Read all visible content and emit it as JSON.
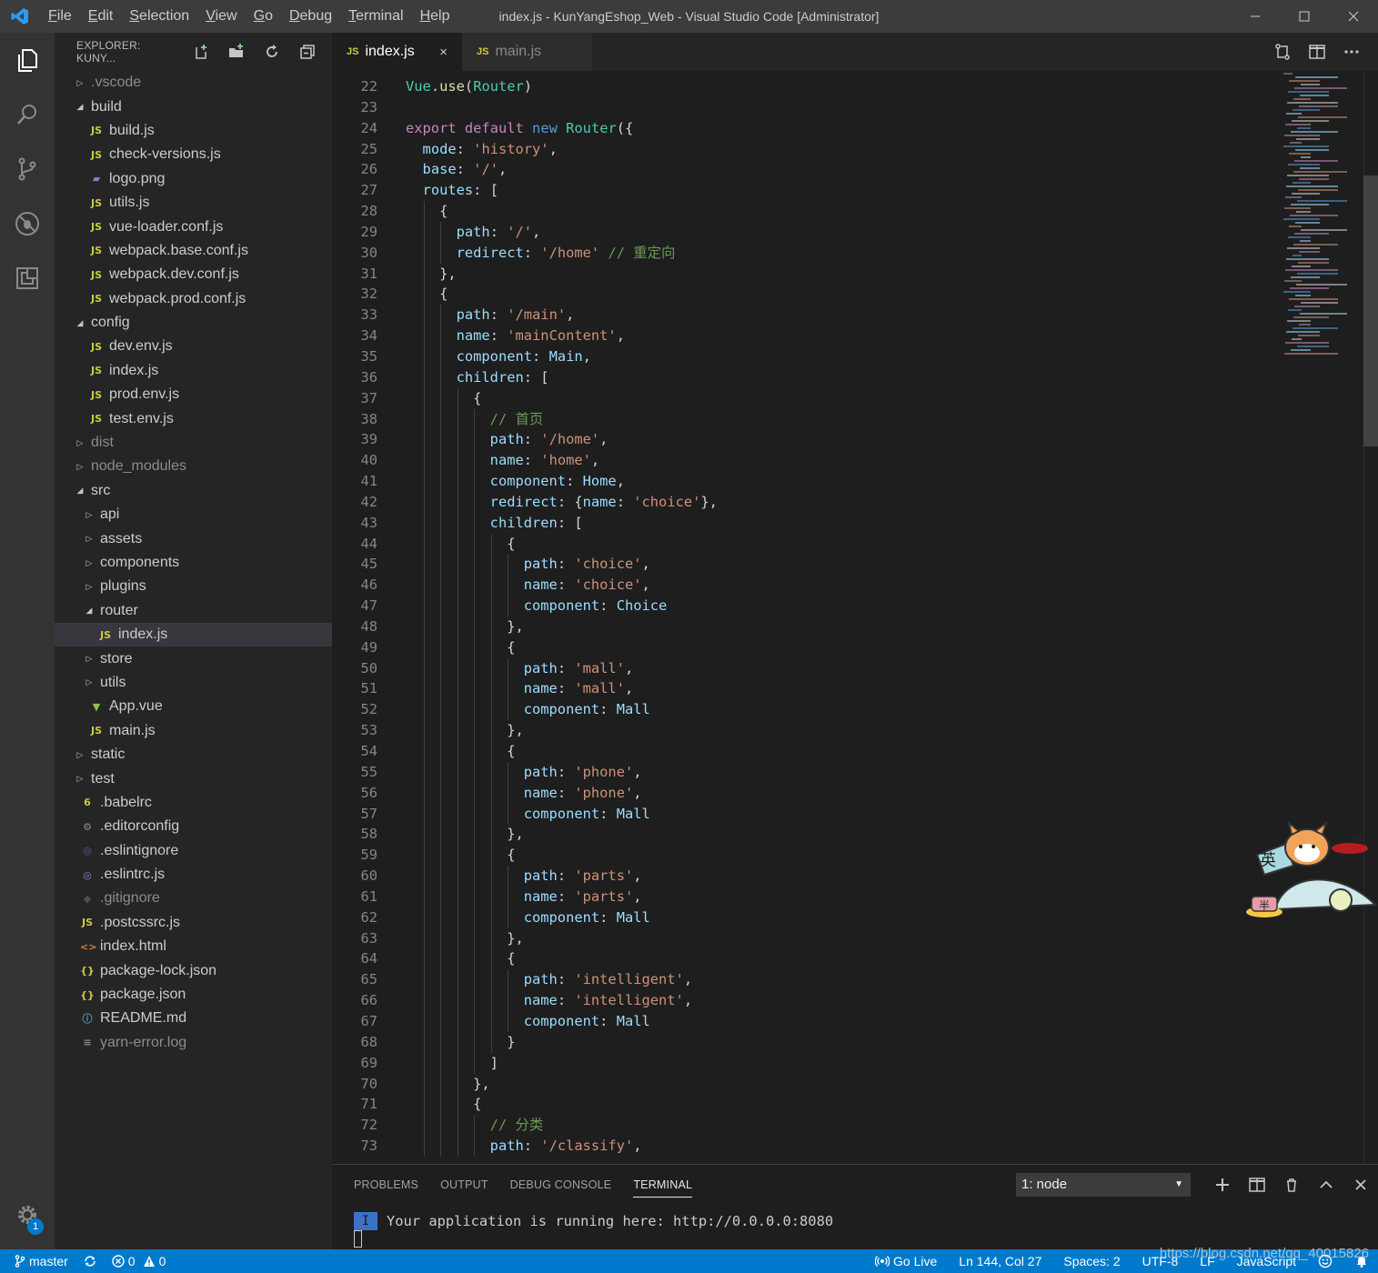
{
  "window": {
    "title": "index.js - KunYangEshop_Web - Visual Studio Code [Administrator]",
    "menu": [
      "File",
      "Edit",
      "Selection",
      "View",
      "Go",
      "Debug",
      "Terminal",
      "Help"
    ],
    "menu_mnemonic_index": [
      0,
      0,
      0,
      0,
      0,
      0,
      0,
      0
    ]
  },
  "activity_bar": {
    "icons": [
      "files-icon",
      "search-icon",
      "source-control-icon",
      "debug-icon",
      "extensions-icon"
    ],
    "settings_badge": "1"
  },
  "explorer": {
    "header": "EXPLORER: KUNY...",
    "tree": [
      {
        "label": ".vscode",
        "depth": 0,
        "kind": "folder",
        "expanded": false,
        "dim": true
      },
      {
        "label": "build",
        "depth": 0,
        "kind": "folder",
        "expanded": true
      },
      {
        "label": "build.js",
        "depth": 1,
        "kind": "js"
      },
      {
        "label": "check-versions.js",
        "depth": 1,
        "kind": "js"
      },
      {
        "label": "logo.png",
        "depth": 1,
        "kind": "image"
      },
      {
        "label": "utils.js",
        "depth": 1,
        "kind": "js"
      },
      {
        "label": "vue-loader.conf.js",
        "depth": 1,
        "kind": "js"
      },
      {
        "label": "webpack.base.conf.js",
        "depth": 1,
        "kind": "js"
      },
      {
        "label": "webpack.dev.conf.js",
        "depth": 1,
        "kind": "js"
      },
      {
        "label": "webpack.prod.conf.js",
        "depth": 1,
        "kind": "js"
      },
      {
        "label": "config",
        "depth": 0,
        "kind": "folder",
        "expanded": true
      },
      {
        "label": "dev.env.js",
        "depth": 1,
        "kind": "js"
      },
      {
        "label": "index.js",
        "depth": 1,
        "kind": "js"
      },
      {
        "label": "prod.env.js",
        "depth": 1,
        "kind": "js"
      },
      {
        "label": "test.env.js",
        "depth": 1,
        "kind": "js"
      },
      {
        "label": "dist",
        "depth": 0,
        "kind": "folder",
        "expanded": false,
        "dim": true
      },
      {
        "label": "node_modules",
        "depth": 0,
        "kind": "folder",
        "expanded": false,
        "dim": true
      },
      {
        "label": "src",
        "depth": 0,
        "kind": "folder",
        "expanded": true
      },
      {
        "label": "api",
        "depth": 1,
        "kind": "folder",
        "expanded": false
      },
      {
        "label": "assets",
        "depth": 1,
        "kind": "folder",
        "expanded": false
      },
      {
        "label": "components",
        "depth": 1,
        "kind": "folder",
        "expanded": false
      },
      {
        "label": "plugins",
        "depth": 1,
        "kind": "folder",
        "expanded": false
      },
      {
        "label": "router",
        "depth": 1,
        "kind": "folder",
        "expanded": true
      },
      {
        "label": "index.js",
        "depth": 2,
        "kind": "js",
        "selected": true
      },
      {
        "label": "store",
        "depth": 1,
        "kind": "folder",
        "expanded": false
      },
      {
        "label": "utils",
        "depth": 1,
        "kind": "folder",
        "expanded": false
      },
      {
        "label": "App.vue",
        "depth": 1,
        "kind": "vue"
      },
      {
        "label": "main.js",
        "depth": 1,
        "kind": "js"
      },
      {
        "label": "static",
        "depth": 0,
        "kind": "folder",
        "expanded": false
      },
      {
        "label": "test",
        "depth": 0,
        "kind": "folder",
        "expanded": false
      },
      {
        "label": ".babelrc",
        "depth": 0,
        "kind": "babel"
      },
      {
        "label": ".editorconfig",
        "depth": 0,
        "kind": "gear"
      },
      {
        "label": ".eslintignore",
        "depth": 0,
        "kind": "eslint-dim"
      },
      {
        "label": ".eslintrc.js",
        "depth": 0,
        "kind": "eslint"
      },
      {
        "label": ".gitignore",
        "depth": 0,
        "kind": "git",
        "dim": true
      },
      {
        "label": ".postcssrc.js",
        "depth": 0,
        "kind": "js"
      },
      {
        "label": "index.html",
        "depth": 0,
        "kind": "html"
      },
      {
        "label": "package-lock.json",
        "depth": 0,
        "kind": "json"
      },
      {
        "label": "package.json",
        "depth": 0,
        "kind": "json"
      },
      {
        "label": "README.md",
        "depth": 0,
        "kind": "info"
      },
      {
        "label": "yarn-error.log",
        "depth": 0,
        "kind": "log",
        "dim": true
      }
    ]
  },
  "tabs": [
    {
      "label": "index.js",
      "badge": "JS",
      "active": true,
      "close": "×"
    },
    {
      "label": "main.js",
      "badge": "JS",
      "active": false
    }
  ],
  "editor": {
    "first_line": 22,
    "lines": [
      {
        "indent": 0,
        "tokens": [
          [
            "cls",
            "Vue"
          ],
          [
            "txt",
            "."
          ],
          [
            "fn",
            "use"
          ],
          [
            "txt",
            "("
          ],
          [
            "cls",
            "Router"
          ],
          [
            "txt",
            ")"
          ]
        ]
      },
      {
        "indent": 0,
        "tokens": []
      },
      {
        "indent": 0,
        "tokens": [
          [
            "kc",
            "export"
          ],
          [
            "txt",
            " "
          ],
          [
            "kc",
            "default"
          ],
          [
            "txt",
            " "
          ],
          [
            "kw",
            "new"
          ],
          [
            "txt",
            " "
          ],
          [
            "cls",
            "Router"
          ],
          [
            "txt",
            "({"
          ]
        ]
      },
      {
        "indent": 1,
        "tokens": [
          [
            "prop",
            "mode"
          ],
          [
            "txt",
            ": "
          ],
          [
            "str",
            "'history'"
          ],
          [
            "txt",
            ","
          ]
        ]
      },
      {
        "indent": 1,
        "tokens": [
          [
            "prop",
            "base"
          ],
          [
            "txt",
            ": "
          ],
          [
            "str",
            "'/'"
          ],
          [
            "txt",
            ","
          ]
        ]
      },
      {
        "indent": 1,
        "tokens": [
          [
            "prop",
            "routes"
          ],
          [
            "txt",
            ": ["
          ]
        ]
      },
      {
        "indent": 2,
        "tokens": [
          [
            "txt",
            "{"
          ]
        ]
      },
      {
        "indent": 3,
        "tokens": [
          [
            "prop",
            "path"
          ],
          [
            "txt",
            ": "
          ],
          [
            "str",
            "'/'"
          ],
          [
            "txt",
            ","
          ]
        ]
      },
      {
        "indent": 3,
        "tokens": [
          [
            "prop",
            "redirect"
          ],
          [
            "txt",
            ": "
          ],
          [
            "str",
            "'/home'"
          ],
          [
            "txt",
            " "
          ],
          [
            "cm",
            "// 重定向"
          ]
        ]
      },
      {
        "indent": 2,
        "tokens": [
          [
            "txt",
            "},"
          ]
        ]
      },
      {
        "indent": 2,
        "tokens": [
          [
            "txt",
            "{"
          ]
        ]
      },
      {
        "indent": 3,
        "tokens": [
          [
            "prop",
            "path"
          ],
          [
            "txt",
            ": "
          ],
          [
            "str",
            "'/main'"
          ],
          [
            "txt",
            ","
          ]
        ]
      },
      {
        "indent": 3,
        "tokens": [
          [
            "prop",
            "name"
          ],
          [
            "txt",
            ": "
          ],
          [
            "str",
            "'mainContent'"
          ],
          [
            "txt",
            ","
          ]
        ]
      },
      {
        "indent": 3,
        "tokens": [
          [
            "prop",
            "component"
          ],
          [
            "txt",
            ": "
          ],
          [
            "prop",
            "Main"
          ],
          [
            "txt",
            ","
          ]
        ]
      },
      {
        "indent": 3,
        "tokens": [
          [
            "prop",
            "children"
          ],
          [
            "txt",
            ": ["
          ]
        ]
      },
      {
        "indent": 4,
        "tokens": [
          [
            "txt",
            "{"
          ]
        ]
      },
      {
        "indent": 5,
        "tokens": [
          [
            "cm",
            "// 首页"
          ]
        ]
      },
      {
        "indent": 5,
        "tokens": [
          [
            "prop",
            "path"
          ],
          [
            "txt",
            ": "
          ],
          [
            "str",
            "'/home'"
          ],
          [
            "txt",
            ","
          ]
        ]
      },
      {
        "indent": 5,
        "tokens": [
          [
            "prop",
            "name"
          ],
          [
            "txt",
            ": "
          ],
          [
            "str",
            "'home'"
          ],
          [
            "txt",
            ","
          ]
        ]
      },
      {
        "indent": 5,
        "tokens": [
          [
            "prop",
            "component"
          ],
          [
            "txt",
            ": "
          ],
          [
            "prop",
            "Home"
          ],
          [
            "txt",
            ","
          ]
        ]
      },
      {
        "indent": 5,
        "tokens": [
          [
            "prop",
            "redirect"
          ],
          [
            "txt",
            ": {"
          ],
          [
            "prop",
            "name"
          ],
          [
            "txt",
            ": "
          ],
          [
            "str",
            "'choice'"
          ],
          [
            "txt",
            "},"
          ]
        ]
      },
      {
        "indent": 5,
        "tokens": [
          [
            "prop",
            "children"
          ],
          [
            "txt",
            ": ["
          ]
        ]
      },
      {
        "indent": 6,
        "tokens": [
          [
            "txt",
            "{"
          ]
        ]
      },
      {
        "indent": 7,
        "tokens": [
          [
            "prop",
            "path"
          ],
          [
            "txt",
            ": "
          ],
          [
            "str",
            "'choice'"
          ],
          [
            "txt",
            ","
          ]
        ]
      },
      {
        "indent": 7,
        "tokens": [
          [
            "prop",
            "name"
          ],
          [
            "txt",
            ": "
          ],
          [
            "str",
            "'choice'"
          ],
          [
            "txt",
            ","
          ]
        ]
      },
      {
        "indent": 7,
        "tokens": [
          [
            "prop",
            "component"
          ],
          [
            "txt",
            ": "
          ],
          [
            "prop",
            "Choice"
          ]
        ]
      },
      {
        "indent": 6,
        "tokens": [
          [
            "txt",
            "},"
          ]
        ]
      },
      {
        "indent": 6,
        "tokens": [
          [
            "txt",
            "{"
          ]
        ]
      },
      {
        "indent": 7,
        "tokens": [
          [
            "prop",
            "path"
          ],
          [
            "txt",
            ": "
          ],
          [
            "str",
            "'mall'"
          ],
          [
            "txt",
            ","
          ]
        ]
      },
      {
        "indent": 7,
        "tokens": [
          [
            "prop",
            "name"
          ],
          [
            "txt",
            ": "
          ],
          [
            "str",
            "'mall'"
          ],
          [
            "txt",
            ","
          ]
        ]
      },
      {
        "indent": 7,
        "tokens": [
          [
            "prop",
            "component"
          ],
          [
            "txt",
            ": "
          ],
          [
            "prop",
            "Mall"
          ]
        ]
      },
      {
        "indent": 6,
        "tokens": [
          [
            "txt",
            "},"
          ]
        ]
      },
      {
        "indent": 6,
        "tokens": [
          [
            "txt",
            "{"
          ]
        ]
      },
      {
        "indent": 7,
        "tokens": [
          [
            "prop",
            "path"
          ],
          [
            "txt",
            ": "
          ],
          [
            "str",
            "'phone'"
          ],
          [
            "txt",
            ","
          ]
        ]
      },
      {
        "indent": 7,
        "tokens": [
          [
            "prop",
            "name"
          ],
          [
            "txt",
            ": "
          ],
          [
            "str",
            "'phone'"
          ],
          [
            "txt",
            ","
          ]
        ]
      },
      {
        "indent": 7,
        "tokens": [
          [
            "prop",
            "component"
          ],
          [
            "txt",
            ": "
          ],
          [
            "prop",
            "Mall"
          ]
        ]
      },
      {
        "indent": 6,
        "tokens": [
          [
            "txt",
            "},"
          ]
        ]
      },
      {
        "indent": 6,
        "tokens": [
          [
            "txt",
            "{"
          ]
        ]
      },
      {
        "indent": 7,
        "tokens": [
          [
            "prop",
            "path"
          ],
          [
            "txt",
            ": "
          ],
          [
            "str",
            "'parts'"
          ],
          [
            "txt",
            ","
          ]
        ]
      },
      {
        "indent": 7,
        "tokens": [
          [
            "prop",
            "name"
          ],
          [
            "txt",
            ": "
          ],
          [
            "str",
            "'parts'"
          ],
          [
            "txt",
            ","
          ]
        ]
      },
      {
        "indent": 7,
        "tokens": [
          [
            "prop",
            "component"
          ],
          [
            "txt",
            ": "
          ],
          [
            "prop",
            "Mall"
          ]
        ]
      },
      {
        "indent": 6,
        "tokens": [
          [
            "txt",
            "},"
          ]
        ]
      },
      {
        "indent": 6,
        "tokens": [
          [
            "txt",
            "{"
          ]
        ]
      },
      {
        "indent": 7,
        "tokens": [
          [
            "prop",
            "path"
          ],
          [
            "txt",
            ": "
          ],
          [
            "str",
            "'intelligent'"
          ],
          [
            "txt",
            ","
          ]
        ]
      },
      {
        "indent": 7,
        "tokens": [
          [
            "prop",
            "name"
          ],
          [
            "txt",
            ": "
          ],
          [
            "str",
            "'intelligent'"
          ],
          [
            "txt",
            ","
          ]
        ]
      },
      {
        "indent": 7,
        "tokens": [
          [
            "prop",
            "component"
          ],
          [
            "txt",
            ": "
          ],
          [
            "prop",
            "Mall"
          ]
        ]
      },
      {
        "indent": 6,
        "tokens": [
          [
            "txt",
            "}"
          ]
        ]
      },
      {
        "indent": 5,
        "tokens": [
          [
            "txt",
            "]"
          ]
        ]
      },
      {
        "indent": 4,
        "tokens": [
          [
            "txt",
            "},"
          ]
        ]
      },
      {
        "indent": 4,
        "tokens": [
          [
            "txt",
            "{"
          ]
        ]
      },
      {
        "indent": 5,
        "tokens": [
          [
            "cm",
            "// 分类"
          ]
        ]
      },
      {
        "indent": 5,
        "tokens": [
          [
            "prop",
            "path"
          ],
          [
            "txt",
            ": "
          ],
          [
            "str",
            "'/classify'"
          ],
          [
            "txt",
            ","
          ]
        ]
      }
    ]
  },
  "panel": {
    "tabs": [
      "PROBLEMS",
      "OUTPUT",
      "DEBUG CONSOLE",
      "TERMINAL"
    ],
    "active_tab": "TERMINAL",
    "terminal_select": "1: node",
    "terminal_badge": "I",
    "terminal_output": "Your application is running here: http://0.0.0.0:8080"
  },
  "mascot": {
    "bubble_char": "英",
    "accent_char": "半"
  },
  "status_bar": {
    "branch": "master",
    "errors": "0",
    "warnings": "0",
    "go_live": "Go Live",
    "position": "Ln 144, Col 27",
    "spaces": "Spaces: 2",
    "encoding": "UTF-8",
    "eol": "LF",
    "language": "JavaScript"
  },
  "watermark": "https://blog.csdn.net/qq_40015826",
  "colors": {
    "accent": "#007acc",
    "js_badge": "#cbcb41",
    "keyword": "#569cd6",
    "control": "#c586c0",
    "string": "#ce9178",
    "property": "#9cdcfe",
    "class": "#4ec9b0",
    "comment": "#6a9955"
  }
}
